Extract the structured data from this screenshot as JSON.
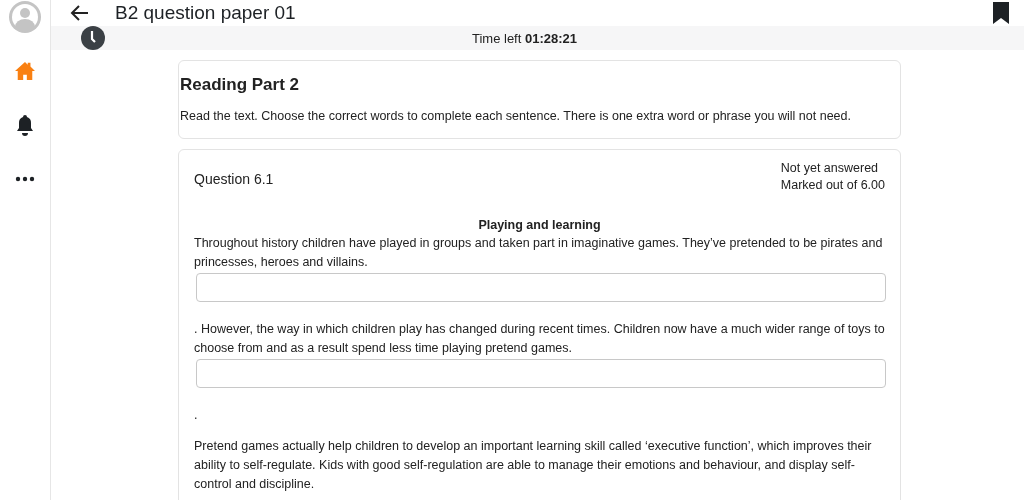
{
  "header": {
    "title": "B2 question paper 01"
  },
  "sidebar": {
    "items": [
      {
        "kind": "home",
        "selected": true
      },
      {
        "kind": "bell",
        "selected": false
      },
      {
        "kind": "more",
        "selected": false
      }
    ]
  },
  "timer": {
    "text": "Time left **01:28:21**"
  },
  "intro": {
    "heading": "Reading Part 2",
    "instructions": "Read the text. Choose the correct words to complete each sentence. There is one extra word or phrase you will not need."
  },
  "question": {
    "title": "Question 6.1",
    "status": "Not yet answered",
    "marks": "Marked out of 6.00",
    "passage_title": "Playing and learning",
    "segments": [
      {
        "kind": "text",
        "text": "Throughout history children have played in groups and taken part in imaginative games. They’ve pretended to be pirates and princesses, heroes and villains."
      },
      {
        "kind": "blank"
      },
      {
        "kind": "text",
        "text": ". However, the way in which children play has changed during recent times. Children now have a much wider range of toys to choose from and as a result spend less time playing pretend games."
      },
      {
        "kind": "blank"
      },
      {
        "kind": "text",
        "text": "."
      },
      {
        "kind": "text",
        "text": "Pretend games actually help children to develop an important learning skill called ‘executive function’, which improves their ability to self-regulate. Kids with good self-regulation are able to manage their emotions and behaviour, and display self-control and discipline."
      }
    ]
  }
}
